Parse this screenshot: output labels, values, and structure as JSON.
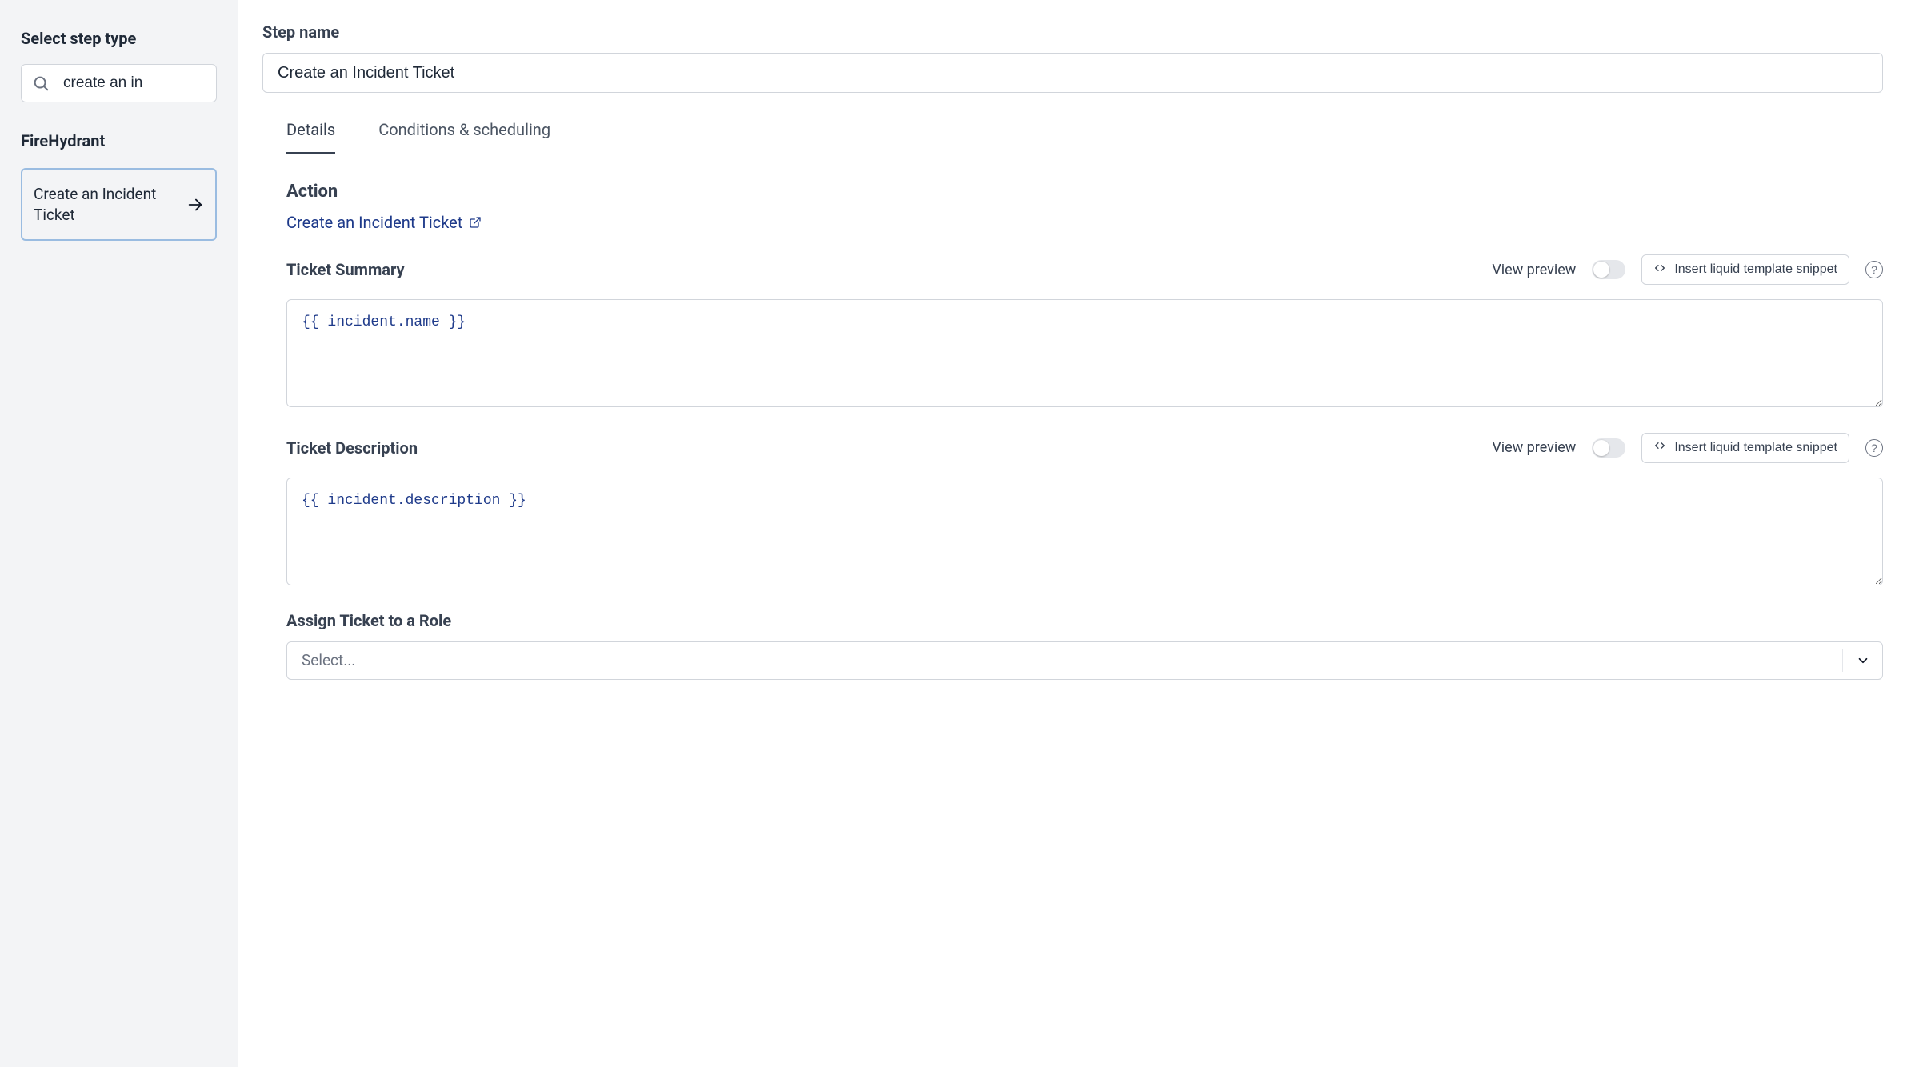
{
  "sidebar": {
    "title": "Select step type",
    "search_value": "create an in",
    "group_title": "FireHydrant",
    "items": [
      {
        "label": "Create an Incident Ticket"
      }
    ]
  },
  "main": {
    "step_name_label": "Step name",
    "step_name_value": "Create an Incident Ticket",
    "tabs": [
      {
        "label": "Details",
        "active": true
      },
      {
        "label": "Conditions & scheduling",
        "active": false
      }
    ],
    "action": {
      "heading": "Action",
      "link_text": "Create an Incident Ticket"
    },
    "summary": {
      "label": "Ticket Summary",
      "preview_label": "View preview",
      "snippet_label": "Insert liquid template snippet",
      "value": "{{ incident.name }}"
    },
    "description": {
      "label": "Ticket Description",
      "preview_label": "View preview",
      "snippet_label": "Insert liquid template snippet",
      "value": "{{ incident.description }}"
    },
    "assign_role": {
      "label": "Assign Ticket to a Role",
      "placeholder": "Select..."
    },
    "help_glyph": "?"
  }
}
